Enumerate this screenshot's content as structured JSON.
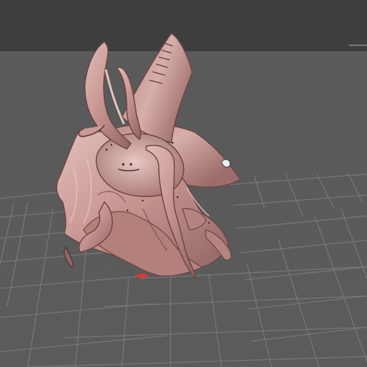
{
  "viewport": {
    "background_top": "#3e3e3e",
    "background_floor": "#5b5b5b",
    "grid_color": "#7a7a7a"
  },
  "model": {
    "icon": "sculpt-model",
    "skin_color": "#c99a96",
    "shadow_color": "#6a4544",
    "highlight_color": "#e4c4c0",
    "accent_color": "#e0362d"
  }
}
